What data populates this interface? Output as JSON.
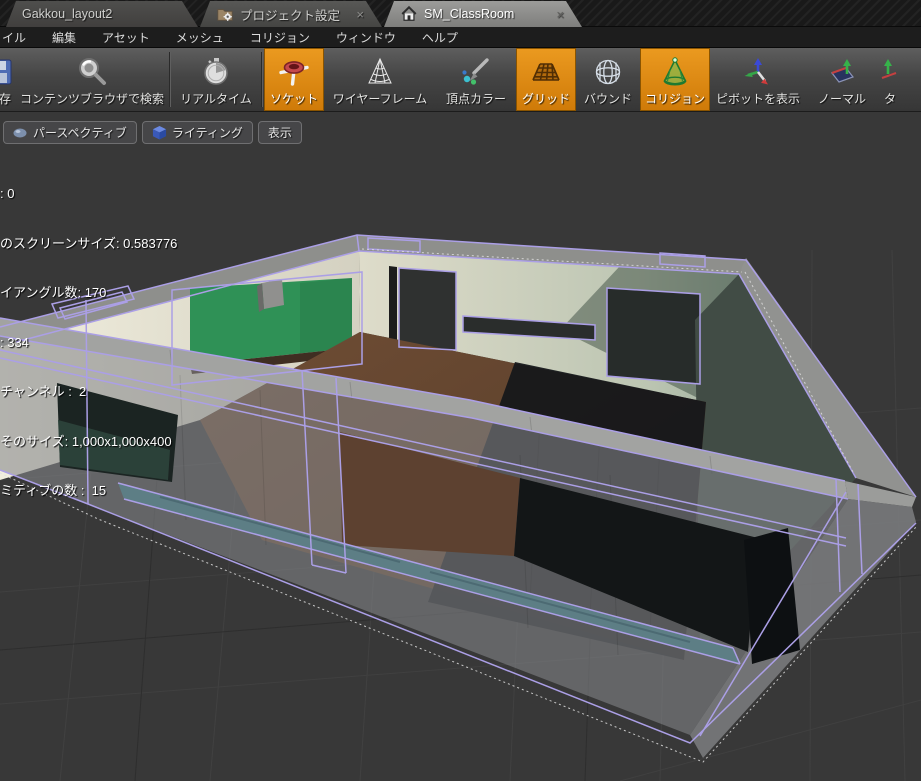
{
  "tabs": [
    {
      "label": "Gakkou_layout2",
      "active": false
    },
    {
      "label": "プロジェクト設定",
      "icon": "folder-gear",
      "close": "×",
      "active": false
    },
    {
      "label": "SM_ClassRoom",
      "icon": "house",
      "close": "×",
      "active": true
    }
  ],
  "menu": {
    "items": [
      "イル",
      "編集",
      "アセット",
      "メッシュ",
      "コリジョン",
      "ウィンドウ",
      "ヘルプ"
    ]
  },
  "toolbar": {
    "items": [
      {
        "label": "存",
        "icon": "save",
        "active": false
      },
      {
        "label": "コンテンツブラウザで検索",
        "icon": "search",
        "active": false
      },
      {
        "label": "リアルタイム",
        "icon": "stopwatch",
        "active": false
      },
      {
        "label": "ソケット",
        "icon": "socket",
        "active": true
      },
      {
        "label": "ワイヤーフレーム",
        "icon": "wireframe",
        "active": false
      },
      {
        "label": "頂点カラー",
        "icon": "vertex-color",
        "active": false
      },
      {
        "label": "グリッド",
        "icon": "grid",
        "active": true
      },
      {
        "label": "バウンド",
        "icon": "bounds",
        "active": false
      },
      {
        "label": "コリジョン",
        "icon": "collision",
        "active": true
      },
      {
        "label": "ピボットを表示",
        "icon": "pivot",
        "active": false
      },
      {
        "label": "ノーマル",
        "icon": "normal",
        "active": false
      },
      {
        "label": "タ",
        "icon": "tangent",
        "active": false
      }
    ],
    "accent_orange": "#d9820e"
  },
  "viewport": {
    "buttons": [
      {
        "label": "パースペクティブ",
        "icon": "perspective"
      },
      {
        "label": "ライティング",
        "icon": "lighting-cube"
      },
      {
        "label": "表示",
        "icon": null
      }
    ],
    "stats": {
      "line1": ": 0",
      "line2": "のスクリーンサイズ: 0.583776",
      "line3": "イアングル数: 170",
      "line4": ": 334",
      "line5": "チャンネル :  2",
      "line6": "そのサイズ: 1,000x1,000x400",
      "line7": "ミティブの数 :  15"
    },
    "scene_colors": {
      "background": "#383838",
      "wall_cream": "#e9e6d8",
      "wall_rim_gray": "#9c9d9b",
      "wall_shadow_teal": "#414c45",
      "chalkboard_green": "#2f9156",
      "floor_brown": "#66452f",
      "floor_shadow": "#14171a",
      "windowsill_teal": "#5d7e85",
      "collision_wire_purple": "#ab9fe6",
      "selection_dotted_white": "#e0e0e0"
    }
  }
}
